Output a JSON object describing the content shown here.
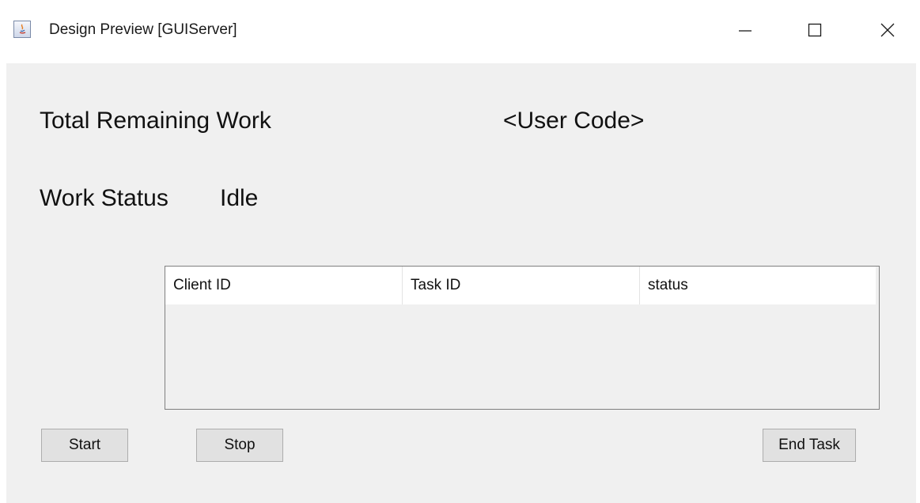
{
  "window": {
    "title": "Design Preview [GUIServer]",
    "app_icon": "java-app-icon",
    "controls": {
      "minimize_icon": "minimize-icon",
      "maximize_icon": "maximize-icon",
      "close_icon": "close-icon"
    }
  },
  "labels": {
    "total_remaining_work": "Total Remaining Work",
    "user_code": "<User Code>",
    "work_status": "Work Status",
    "work_status_value": "Idle"
  },
  "table": {
    "columns": [
      "Client ID",
      "Task ID",
      "status"
    ],
    "rows": []
  },
  "buttons": {
    "start": "Start",
    "stop": "Stop",
    "end_task": "End Task"
  },
  "colors": {
    "content_background": "#f0f0f0",
    "button_background": "#e1e1e1",
    "table_border": "#7f7f7f"
  }
}
